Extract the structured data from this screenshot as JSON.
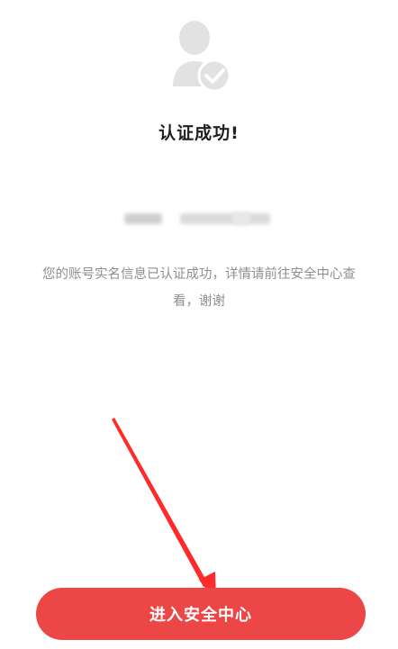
{
  "page": {
    "title": "认证成功!",
    "description": "您的账号实名信息已认证成功，详情请前往安全中心查看，谢谢"
  },
  "icons": {
    "status": "verified-user-icon",
    "annotation": "red-arrow-pointing-to-button"
  },
  "actions": {
    "primary_label": "进入安全中心"
  },
  "colors": {
    "primary": "#ec4646",
    "title": "#1f1f1f",
    "muted_text": "#8f8f8f",
    "icon": "#e2e2e2",
    "annotation": "#ff2a2a"
  }
}
